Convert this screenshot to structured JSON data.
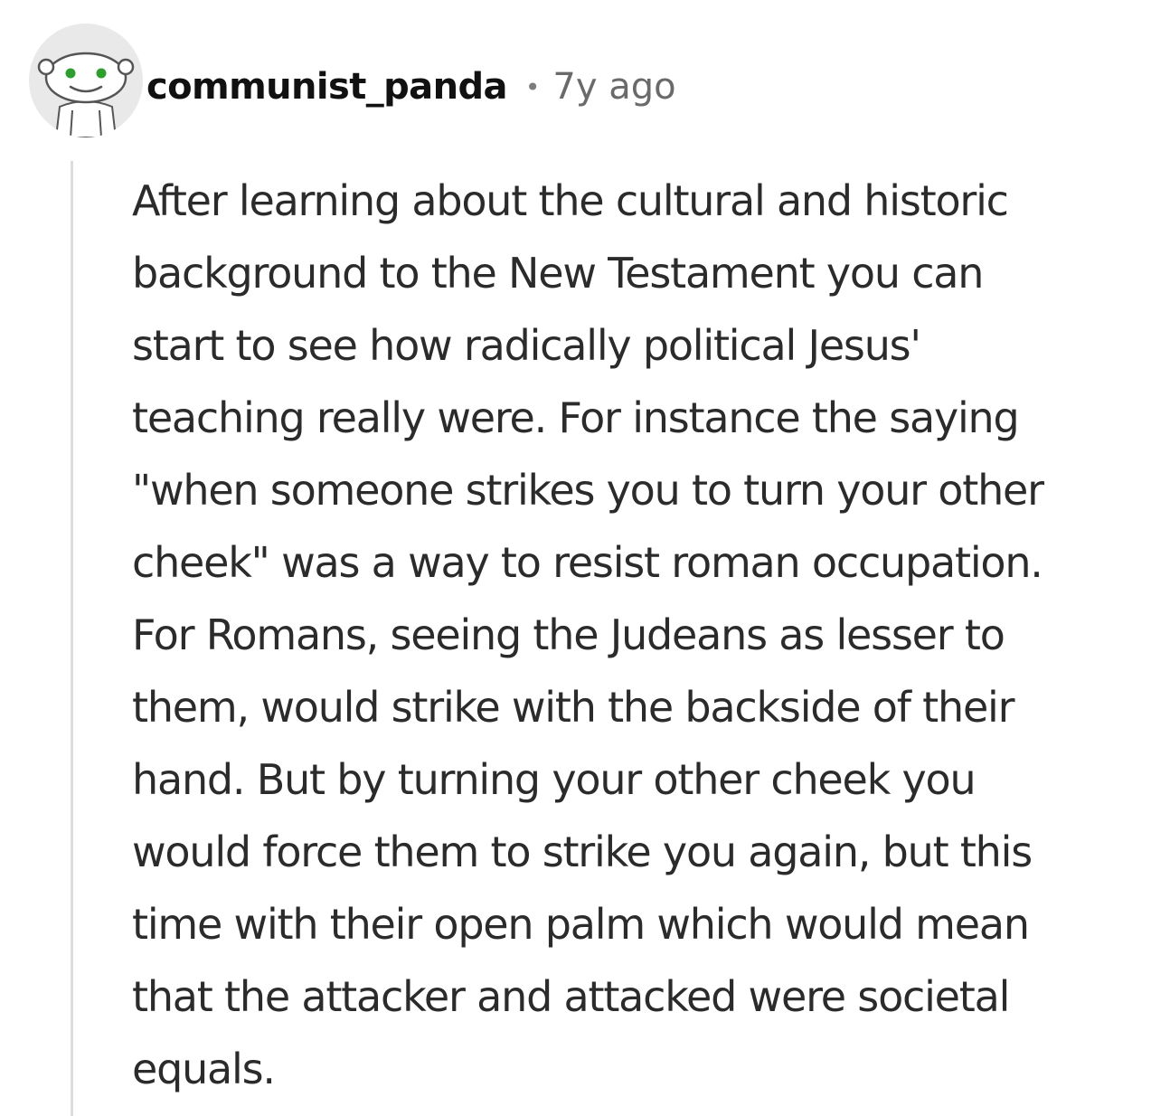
{
  "comment": {
    "username": "communist_panda",
    "separator": "•",
    "age": "7y ago",
    "avatar_icon": "snoo-avatar-icon",
    "body_lines": [
      "After learning about the cultural and historic",
      "background to the New Testament you can",
      "start to see how radically political Jesus'",
      "teaching really were. For instance the saying",
      "\"when someone strikes you to turn your other",
      "cheek\" was a way to resist roman occupation.",
      "For Romans, seeing the Judeans as lesser to",
      "them, would strike with the backside of their",
      "hand. But by turning your other cheek you",
      "would force them to strike you again, but this",
      "time with their open palm which would mean",
      "that the attacker and attacked were societal",
      "equals."
    ]
  },
  "colors": {
    "username": "#111111",
    "meta": "#6a6a6a",
    "body": "#2b2b2b",
    "thread_line": "#dcdcdc",
    "avatar_bg": "#e9e9e9",
    "avatar_eyes": "#2e9e2e"
  }
}
